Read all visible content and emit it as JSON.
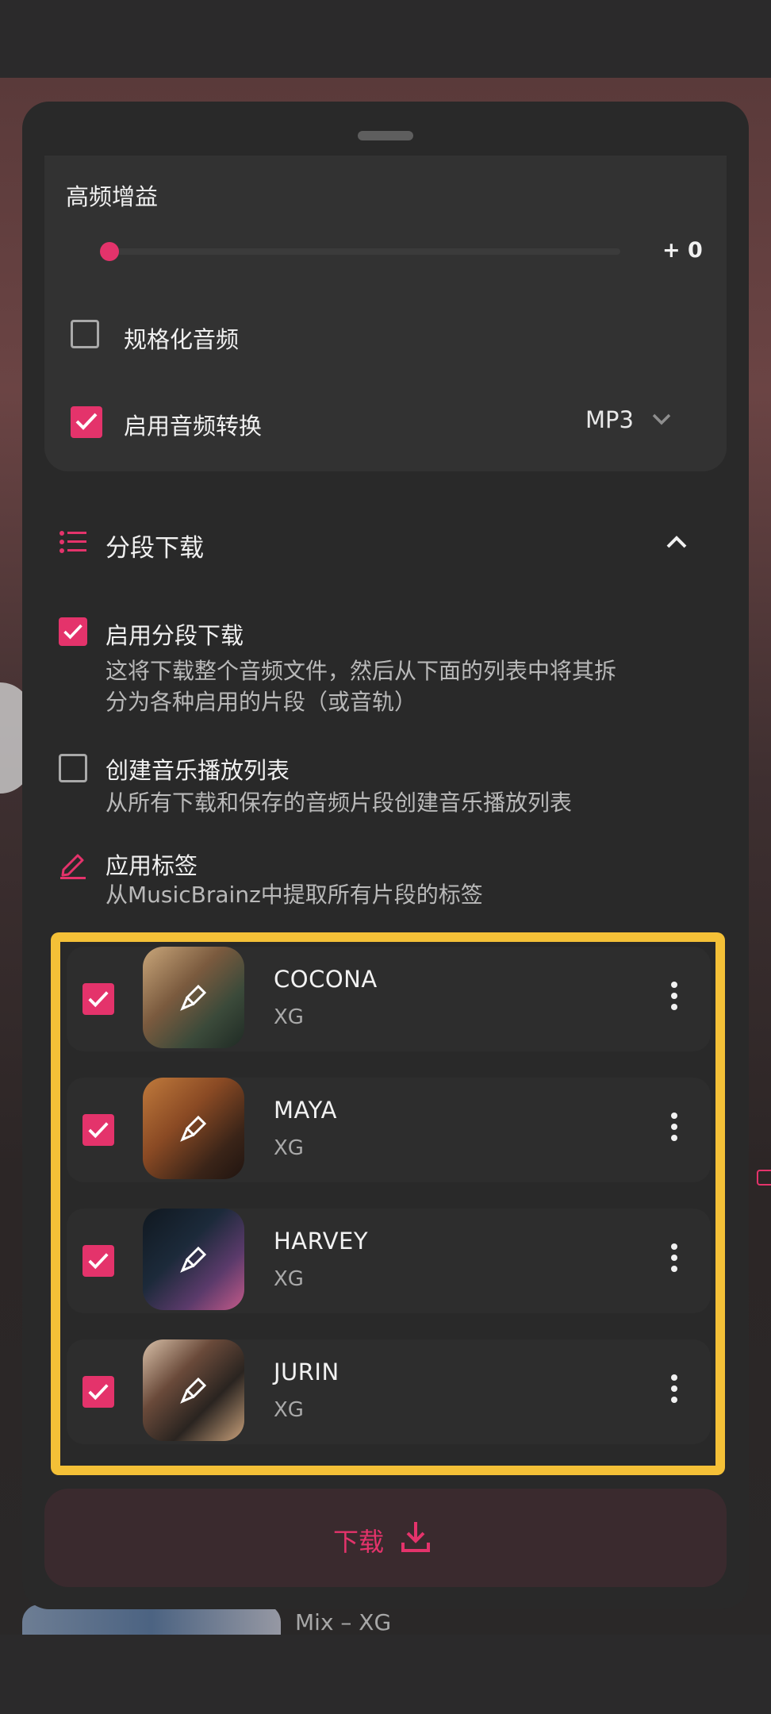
{
  "audio": {
    "treble_gain_label": "高频增益",
    "treble_gain_value": "+ 0",
    "treble_gain_level": 0,
    "normalize_label": "规格化音频",
    "normalize_checked": false,
    "convert_label": "启用音频转换",
    "convert_checked": true,
    "convert_format": "MP3"
  },
  "segments": {
    "section_title": "分段下载",
    "enable_label": "启用分段下载",
    "enable_desc_line1": "这将下载整个音频文件，然后从下面的列表中将其拆",
    "enable_desc_line2": "分为各种启用的片段（或音轨）",
    "playlist_label": "创建音乐播放列表",
    "playlist_desc": "从所有下载和保存的音频片段创建音乐播放列表",
    "tags_label": "应用标签",
    "tags_desc": "从MusicBrainz中提取所有片段的标签"
  },
  "tracks": [
    {
      "title": "COCONA",
      "artist": "XG",
      "checked": true
    },
    {
      "title": "MAYA",
      "artist": "XG",
      "checked": true
    },
    {
      "title": "HARVEY",
      "artist": "XG",
      "checked": true
    },
    {
      "title": "JURIN",
      "artist": "XG",
      "checked": true
    }
  ],
  "download_label": "下载",
  "background": {
    "mix_text": "Mix – XG"
  },
  "colors": {
    "accent": "#e4336b",
    "highlight": "#f4c037",
    "sheet": "#292929"
  }
}
